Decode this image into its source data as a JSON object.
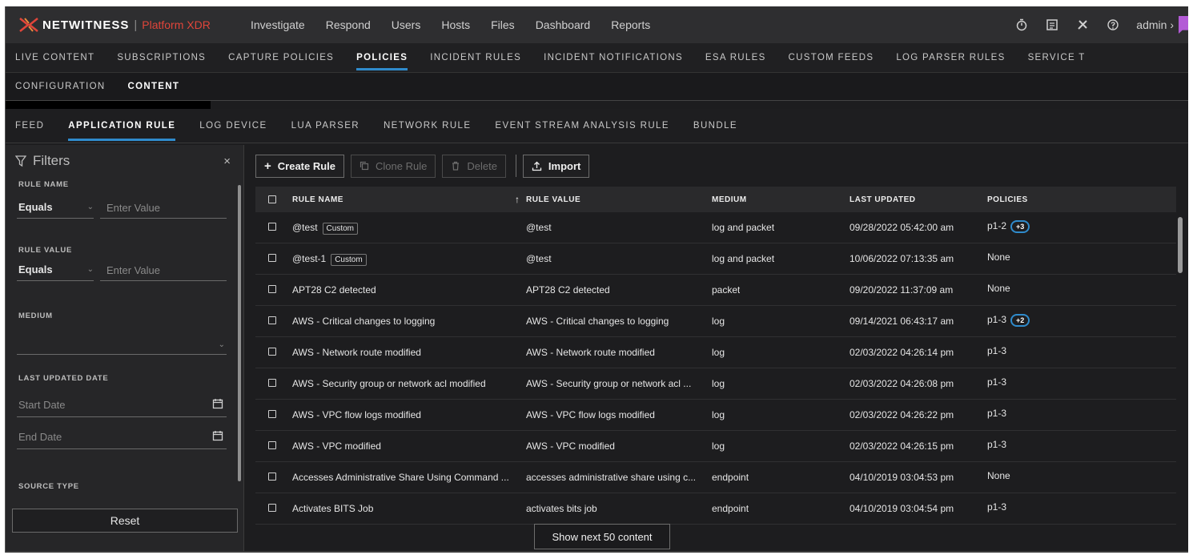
{
  "brand": {
    "name": "NETWITNESS",
    "separator": "|",
    "product": "Platform XDR"
  },
  "topnav": [
    "Investigate",
    "Respond",
    "Users",
    "Hosts",
    "Files",
    "Dashboard",
    "Reports"
  ],
  "user": {
    "name": "admin",
    "suffix": "›"
  },
  "admin_tabs": [
    {
      "label": "LIVE CONTENT"
    },
    {
      "label": "SUBSCRIPTIONS"
    },
    {
      "label": "CAPTURE POLICIES"
    },
    {
      "label": "POLICIES",
      "active": true
    },
    {
      "label": "INCIDENT RULES"
    },
    {
      "label": "INCIDENT NOTIFICATIONS"
    },
    {
      "label": "ESA RULES"
    },
    {
      "label": "CUSTOM FEEDS"
    },
    {
      "label": "LOG PARSER RULES"
    },
    {
      "label": "SERVICE T"
    }
  ],
  "sub_tabs": [
    {
      "label": "CONFIGURATION"
    },
    {
      "label": "CONTENT",
      "active": true
    }
  ],
  "type_tabs": [
    {
      "label": "FEED"
    },
    {
      "label": "APPLICATION RULE",
      "active": true
    },
    {
      "label": "LOG DEVICE"
    },
    {
      "label": "LUA PARSER"
    },
    {
      "label": "NETWORK RULE"
    },
    {
      "label": "EVENT STREAM ANALYSIS RULE"
    },
    {
      "label": "BUNDLE"
    }
  ],
  "filters": {
    "title": "Filters",
    "close": "×",
    "rule_name": {
      "label": "RULE NAME",
      "operator": "Equals",
      "placeholder": "Enter Value"
    },
    "rule_value": {
      "label": "RULE VALUE",
      "operator": "Equals",
      "placeholder": "Enter Value"
    },
    "medium": {
      "label": "MEDIUM"
    },
    "last_updated": {
      "label": "LAST UPDATED DATE",
      "start_placeholder": "Start Date",
      "end_placeholder": "End Date"
    },
    "source_type": {
      "label": "SOURCE TYPE"
    },
    "reset": "Reset"
  },
  "toolbar": {
    "create": "Create Rule",
    "clone": "Clone Rule",
    "delete": "Delete",
    "import": "Import"
  },
  "table": {
    "columns": {
      "name": "RULE NAME",
      "sort": "↑",
      "value": "RULE VALUE",
      "medium": "MEDIUM",
      "updated": "LAST UPDATED",
      "policies": "POLICIES"
    },
    "rows": [
      {
        "name": "@test",
        "tag": "Custom",
        "value": "@test",
        "medium": "log and packet",
        "updated": "09/28/2022 05:42:00 am",
        "policies": "p1-2",
        "more": "+3"
      },
      {
        "name": "@test-1",
        "tag": "Custom",
        "value": "@test",
        "medium": "log and packet",
        "updated": "10/06/2022 07:13:35 am",
        "policies": "None"
      },
      {
        "name": "APT28 C2 detected",
        "value": "APT28 C2 detected",
        "medium": "packet",
        "updated": "09/20/2022 11:37:09 am",
        "policies": "None"
      },
      {
        "name": "AWS - Critical changes to logging",
        "value": "AWS - Critical changes to logging",
        "medium": "log",
        "updated": "09/14/2021 06:43:17 am",
        "policies": "p1-3",
        "more": "+2"
      },
      {
        "name": "AWS - Network route modified",
        "value": "AWS - Network route modified",
        "medium": "log",
        "updated": "02/03/2022 04:26:14 pm",
        "policies": "p1-3"
      },
      {
        "name": "AWS - Security group or network acl modified",
        "value": "AWS - Security group or network acl ...",
        "medium": "log",
        "updated": "02/03/2022 04:26:08 pm",
        "policies": "p1-3"
      },
      {
        "name": "AWS - VPC flow logs modified",
        "value": "AWS - VPC flow logs modified",
        "medium": "log",
        "updated": "02/03/2022 04:26:22 pm",
        "policies": "p1-3"
      },
      {
        "name": "AWS - VPC modified",
        "value": "AWS - VPC modified",
        "medium": "log",
        "updated": "02/03/2022 04:26:15 pm",
        "policies": "p1-3"
      },
      {
        "name": "Accesses Administrative Share Using Command ...",
        "value": "accesses administrative share using c...",
        "medium": "endpoint",
        "updated": "04/10/2019 03:04:53 pm",
        "policies": "None"
      },
      {
        "name": "Activates BITS Job",
        "value": "activates bits job",
        "medium": "endpoint",
        "updated": "04/10/2019 03:04:54 pm",
        "policies": "p1-3"
      }
    ]
  },
  "show_next": "Show next 50 content",
  "colors": {
    "accent": "#2f8bcc",
    "brand_red": "#e0453a",
    "bg": "#1d1d1f"
  }
}
